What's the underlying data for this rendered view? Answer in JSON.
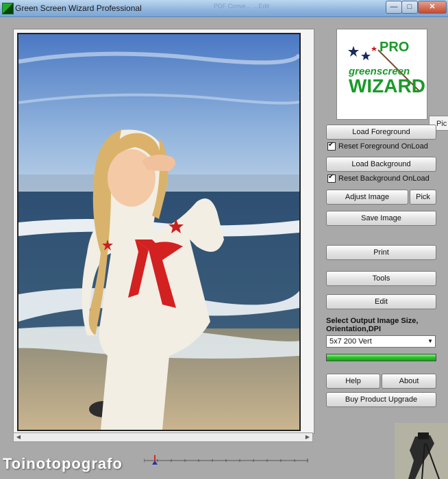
{
  "window": {
    "title": "Green Screen Wizard Professional",
    "ghost_1": "PDF Conve...",
    "ghost_2": "...Edit",
    "minimize": "—",
    "maximize": "□",
    "close": "✕"
  },
  "panel": {
    "logo": {
      "top": "PRO",
      "middle": "greenscreen",
      "bottom": "WIZARD"
    },
    "pick_top": "Pic",
    "load_foreground": "Load Foreground",
    "reset_foreground": "Reset Foreground OnLoad",
    "load_background": "Load Background",
    "reset_background": "Reset Background OnLoad",
    "adjust_image": "Adjust Image",
    "pick": "Pick",
    "save_image": "Save Image",
    "print": "Print",
    "tools": "Tools",
    "edit": "Edit",
    "size_label": "Select Output Image Size, Orientation,DPI",
    "size_value": "5x7 200 Vert",
    "progress_fraction": 1.0,
    "help": "Help",
    "about": "About",
    "upgrade": "Buy Product Upgrade"
  },
  "watermark": "Toinotopografo",
  "colors": {
    "progress": "#25c425",
    "logo_green": "#1a9a2a",
    "titlebar": "#8fb5dd"
  }
}
